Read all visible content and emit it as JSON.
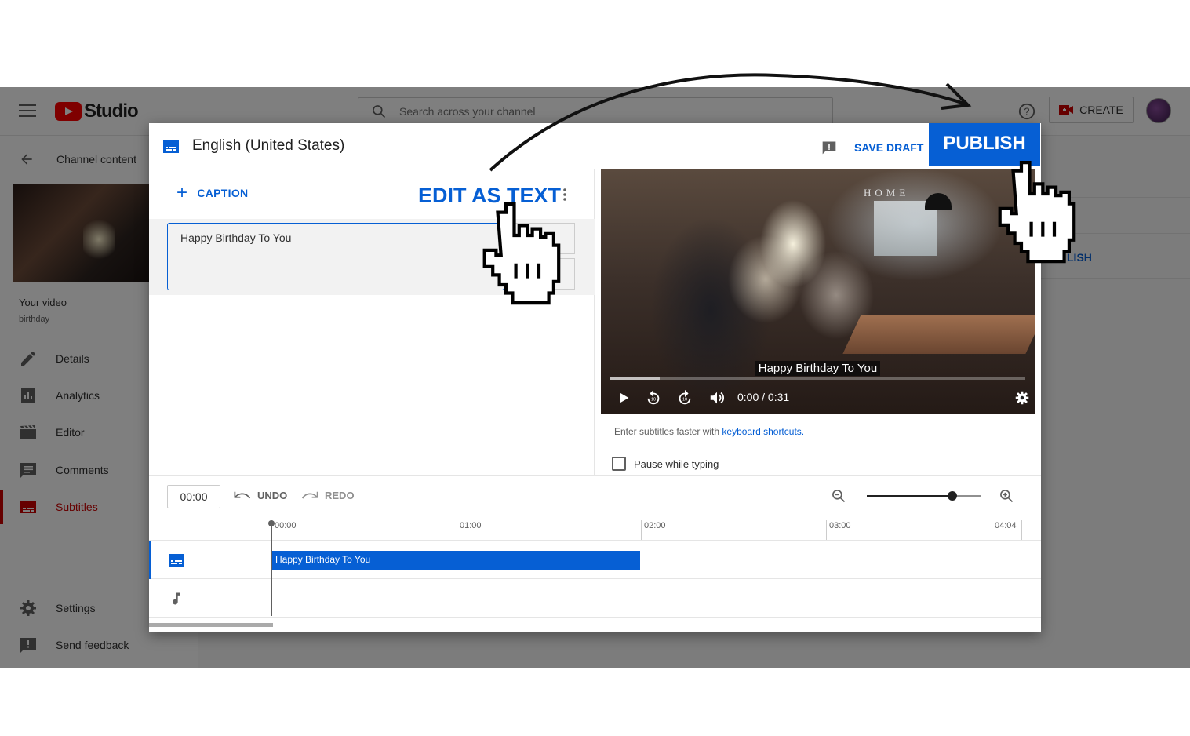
{
  "header": {
    "logo_text": "Studio",
    "search_placeholder": "Search across your channel",
    "create_label": "CREATE"
  },
  "sidebar": {
    "back_label": "Channel content",
    "your_video_label": "Your video",
    "video_title": "birthday",
    "items": [
      {
        "label": "Details",
        "icon": "pencil-icon"
      },
      {
        "label": "Analytics",
        "icon": "analytics-icon"
      },
      {
        "label": "Editor",
        "icon": "clapper-icon"
      },
      {
        "label": "Comments",
        "icon": "comments-icon"
      },
      {
        "label": "Subtitles",
        "icon": "subtitles-icon",
        "active": true
      }
    ],
    "bottom_items": [
      {
        "label": "Settings",
        "icon": "gear-icon"
      },
      {
        "label": "Send feedback",
        "icon": "feedback-icon"
      }
    ]
  },
  "background": {
    "publish_partial": "LISH"
  },
  "dialog": {
    "title": "English (United States)",
    "save_draft_label": "SAVE DRAFT",
    "publish_label": "PUBLISH",
    "add_caption_label": "CAPTION",
    "edit_as_text_label": "EDIT AS TEXT",
    "caption_text": "Happy Birthday To You",
    "video": {
      "overlay_caption": "Happy Birthday To You",
      "time": "0:00 / 0:31",
      "sign_text": "HOME",
      "progress_buffered": 0.12
    },
    "hint_prefix": "Enter subtitles faster with ",
    "hint_link": "keyboard shortcuts.",
    "pause_label": "Pause while typing",
    "timeline": {
      "current_time": "00:00",
      "undo_label": "UNDO",
      "redo_label": "REDO",
      "zoom_level": 0.75,
      "ticks": [
        "00:00",
        "01:00",
        "02:00",
        "03:00",
        "04:04"
      ],
      "segment_text": "Happy Birthday To You"
    }
  },
  "colors": {
    "accent": "#065fd4",
    "brand_red": "#ff0000",
    "active_red": "#cc0000"
  }
}
